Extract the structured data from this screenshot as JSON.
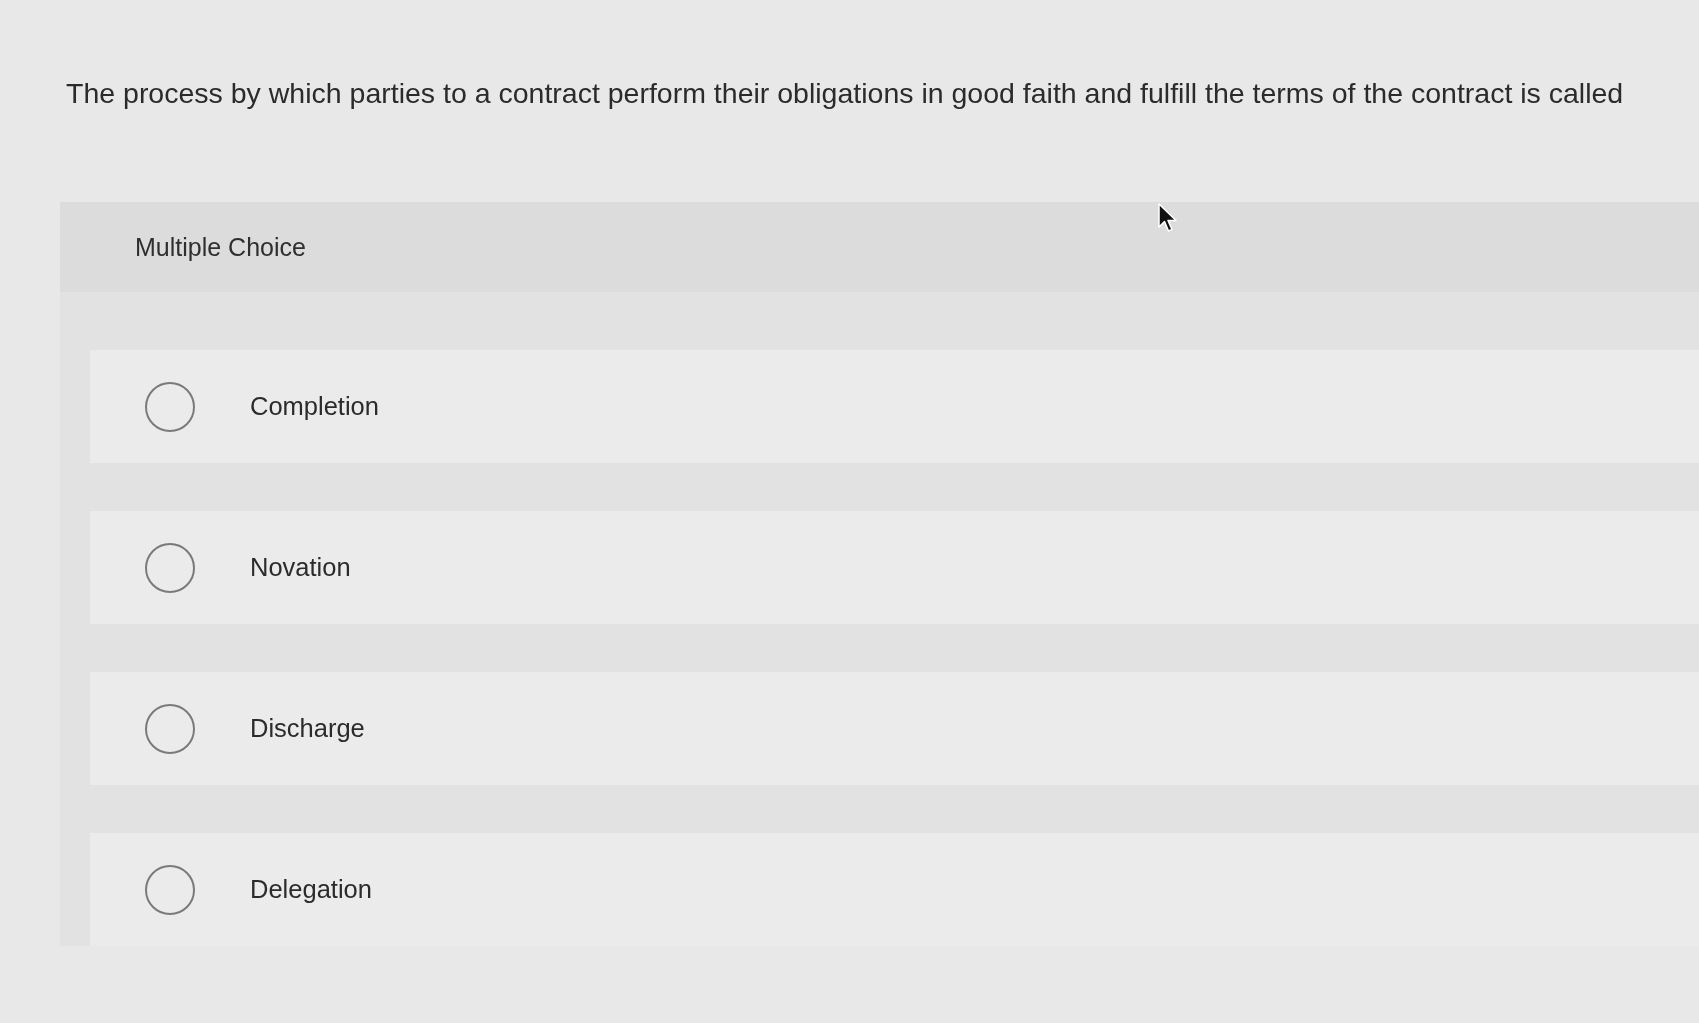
{
  "question": "The process by which parties to a contract perform their obligations in good faith and fulfill the terms of the contract is called",
  "question_type": "Multiple Choice",
  "options": [
    {
      "label": "Completion",
      "selected": false
    },
    {
      "label": "Novation",
      "selected": false
    },
    {
      "label": "Discharge",
      "selected": false
    },
    {
      "label": "Delegation",
      "selected": false
    }
  ]
}
